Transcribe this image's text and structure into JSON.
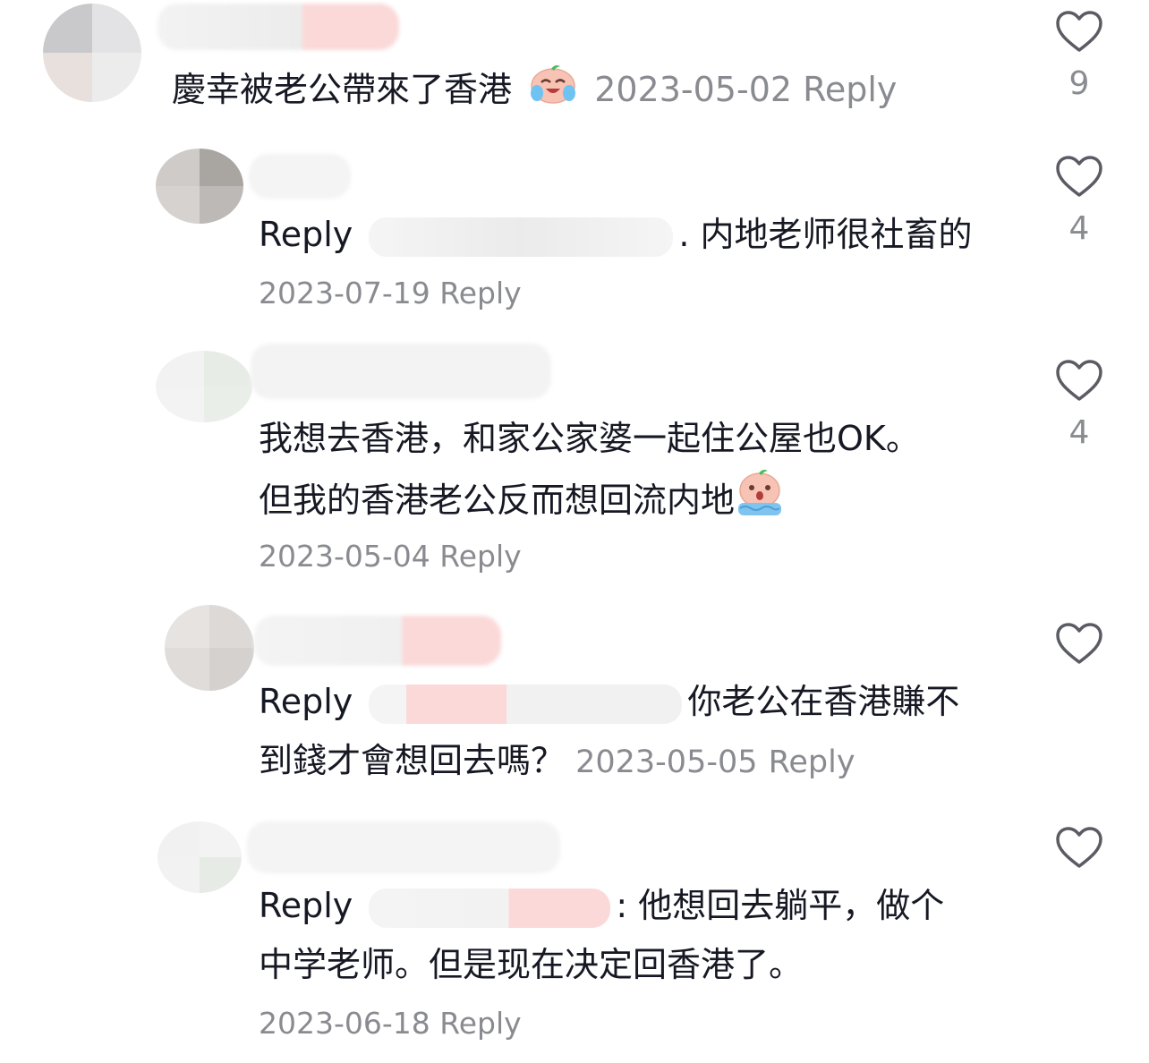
{
  "comments": [
    {
      "text": "慶幸被老公帶來了香港",
      "date": "2023-05-02",
      "reply_label": "Reply",
      "likes": "9"
    },
    {
      "reply_prefix": "Reply",
      "text": ". 内地老师很社畜的",
      "date": "2023-07-19",
      "reply_label": "Reply",
      "likes": "4"
    },
    {
      "text_line1": "我想去香港，和家公家婆一起住公屋也OK。",
      "text_line2": "但我的香港老公反而想回流内地",
      "date": "2023-05-04",
      "reply_label": "Reply",
      "likes": "4"
    },
    {
      "reply_prefix": "Reply",
      "text_line1": "你老公在香港賺不",
      "text_line2": "到錢才會想回去嗎？",
      "date": "2023-05-05",
      "reply_label": "Reply",
      "likes": ""
    },
    {
      "reply_prefix": "Reply",
      "text_line1": ": 他想回去躺平，做个",
      "text_line2": "中学老师。但是现在决定回香港了。",
      "date": "2023-06-18",
      "reply_label": "Reply",
      "likes": ""
    }
  ],
  "colors": {
    "text": "#161823",
    "meta": "#8a8b91",
    "icon": "#5a5b63"
  },
  "icons": {
    "like": "heart-outline-icon",
    "emoji_1": "crying-laughing-emoji-icon",
    "emoji_2": "sobbing-emoji-icon"
  }
}
